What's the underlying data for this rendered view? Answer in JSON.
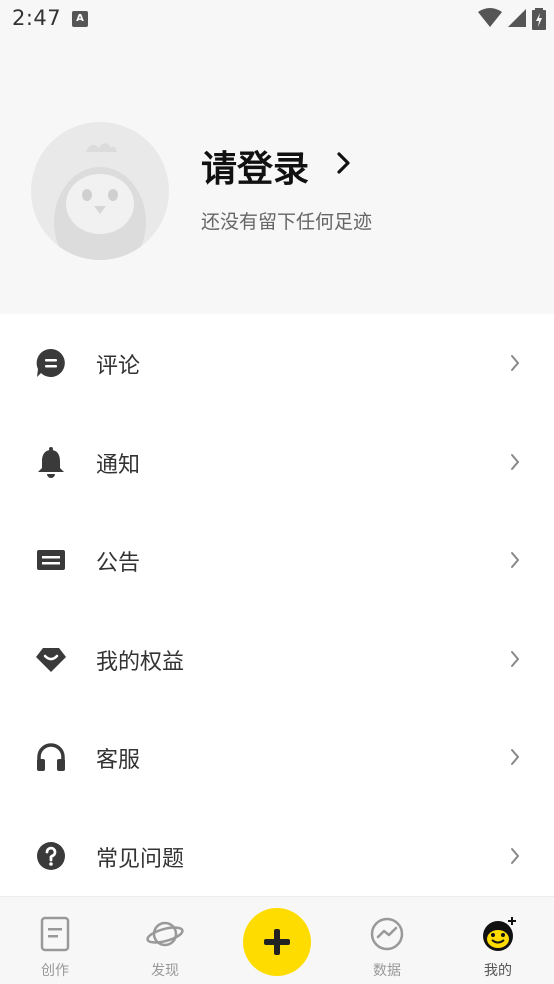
{
  "status_bar": {
    "time": "2:47",
    "notification_icon": "A",
    "icons": [
      "wifi-icon",
      "signal-icon",
      "battery-charging-icon"
    ]
  },
  "profile": {
    "login_title": "请登录",
    "subtitle": "还没有留下任何足迹",
    "avatar_icon": "penguin-avatar-icon"
  },
  "menu": {
    "items": [
      {
        "label": "评论",
        "icon": "comment-icon"
      },
      {
        "label": "通知",
        "icon": "bell-icon"
      },
      {
        "label": "公告",
        "icon": "announcement-icon"
      },
      {
        "label": "我的权益",
        "icon": "benefits-icon"
      },
      {
        "label": "客服",
        "icon": "headset-icon"
      },
      {
        "label": "常见问题",
        "icon": "help-icon"
      }
    ]
  },
  "bottom_nav": {
    "items": [
      {
        "label": "创作",
        "icon": "document-icon"
      },
      {
        "label": "发现",
        "icon": "planet-icon"
      },
      {
        "label": "",
        "icon": "plus-icon"
      },
      {
        "label": "数据",
        "icon": "chart-icon"
      },
      {
        "label": "我的",
        "icon": "penguin-icon"
      }
    ],
    "active": "我的"
  },
  "colors": {
    "accent": "#ffdc00",
    "header_bg": "#f7f7f7",
    "icon": "#3a3a3a",
    "text": "#333333",
    "subtext": "#666666"
  }
}
